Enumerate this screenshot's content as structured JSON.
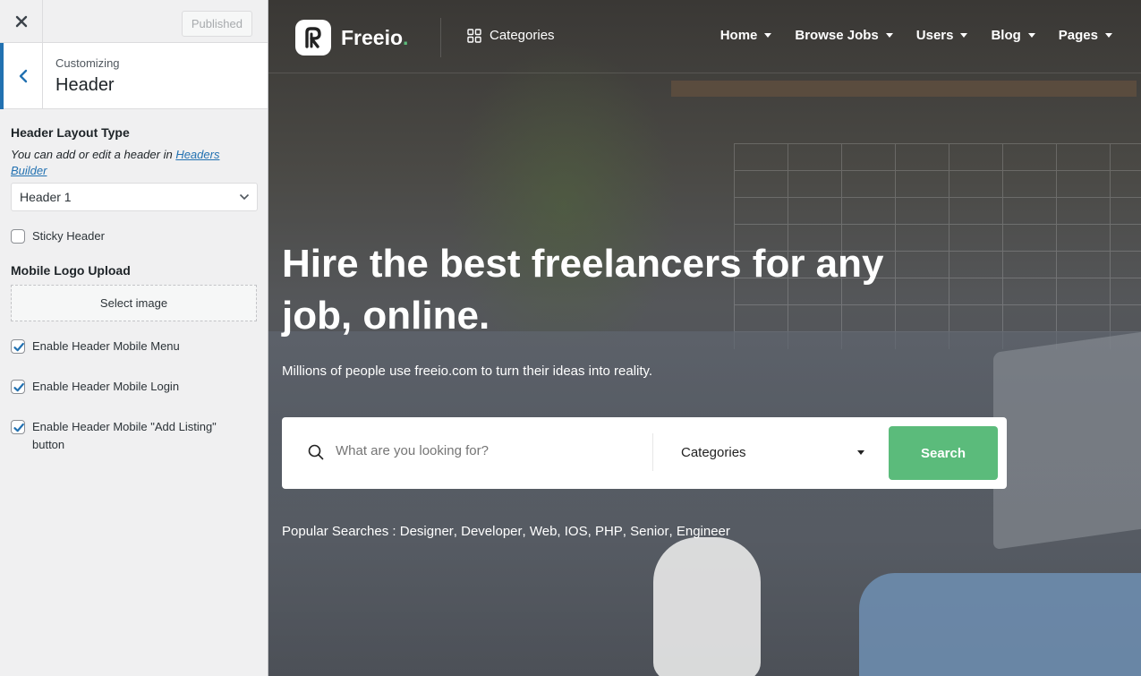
{
  "customizer": {
    "published_label": "Published",
    "customizing_label": "Customizing",
    "section_title": "Header",
    "header_layout_title": "Header Layout Type",
    "header_layout_desc": "You can add or edit a header in ",
    "header_layout_link": "Headers Builder",
    "header_select_value": "Header 1",
    "sticky_header_label": "Sticky Header",
    "sticky_header_checked": false,
    "mobile_logo_title": "Mobile Logo Upload",
    "select_image_label": "Select image",
    "mobile_menu_label": "Enable Header Mobile Menu",
    "mobile_login_label": "Enable Header Mobile Login",
    "mobile_add_listing_label": "Enable Header Mobile \"Add Listing\" button"
  },
  "site": {
    "logo_text": "Freeio",
    "logo_dot": ".",
    "categories_label": "Categories",
    "menu": [
      "Home",
      "Browse Jobs",
      "Users",
      "Blog",
      "Pages"
    ],
    "hero_title": "Hire the best freelancers for any job, online.",
    "hero_subtitle": "Millions of people use freeio.com to turn their ideas into reality.",
    "search_placeholder": "What are you looking for?",
    "search_category": "Categories",
    "search_button": "Search",
    "popular_label": "Popular Searches :",
    "popular_terms": [
      "Designer",
      "Developer",
      "Web",
      "IOS",
      "PHP",
      "Senior",
      "Engineer"
    ],
    "accent_color": "#5bbb7b"
  }
}
